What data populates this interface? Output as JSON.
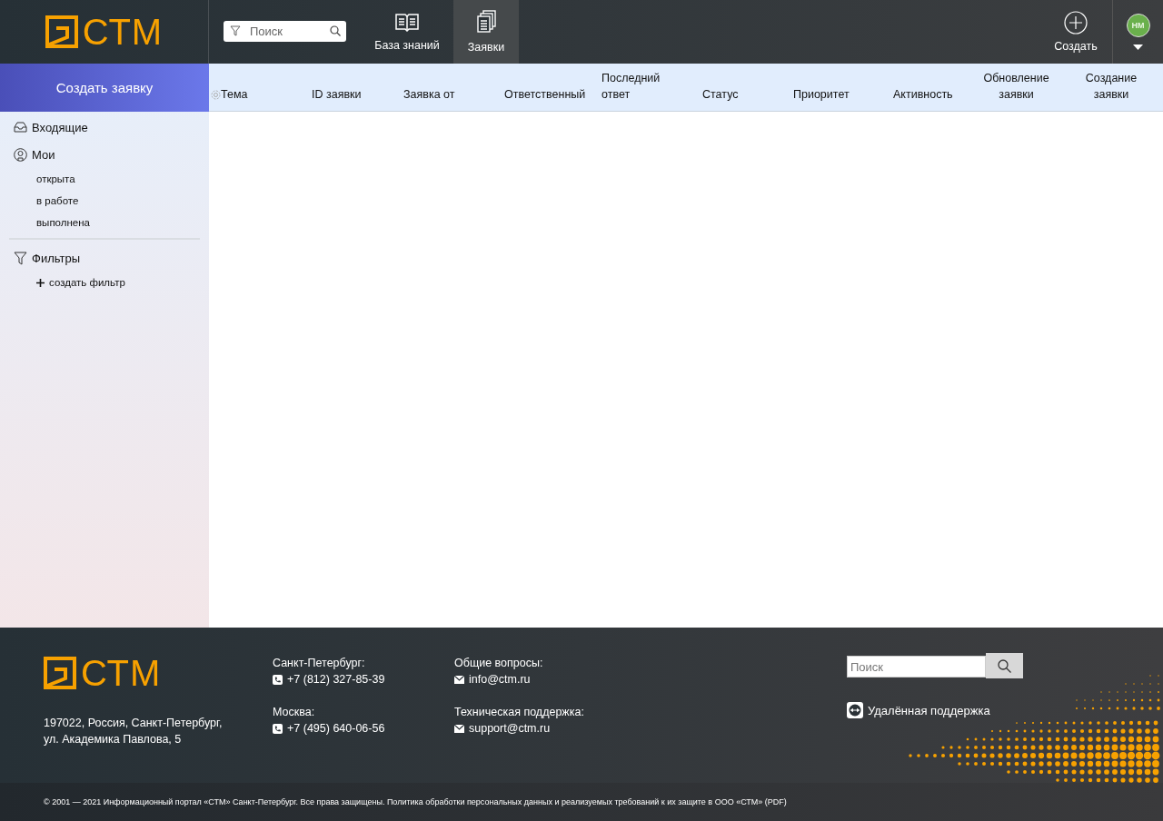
{
  "header": {
    "logo": "СТМ",
    "search": {
      "placeholder": "Поиск"
    },
    "nav": [
      {
        "label": "База знаний",
        "selected": false
      },
      {
        "label": "Заявки",
        "selected": true
      }
    ],
    "create": "Создать",
    "user": {
      "initials": "НМ"
    }
  },
  "sidebar": {
    "create_button": "Создать заявку",
    "items": [
      {
        "label": "Входящие"
      },
      {
        "label": "Мои",
        "children": [
          {
            "label": "открыта"
          },
          {
            "label": "в работе"
          },
          {
            "label": "выполнена"
          }
        ]
      }
    ],
    "filters": {
      "label": "Фильтры",
      "create": "создать фильтр"
    }
  },
  "table": {
    "columns": [
      "Тема",
      "ID заявки",
      "Заявка от",
      "Ответственный",
      "Последний ответ",
      "Статус",
      "Приоритет",
      "Активность",
      "Обновление заявки",
      "Создание заявки"
    ]
  },
  "footer": {
    "logo": "СТМ",
    "address": [
      "197022, Россия, Санкт-Петербург,",
      "ул. Академика Павлова, 5"
    ],
    "contacts": [
      {
        "title": "Санкт-Петербург:",
        "value": "+7 (812) 327-85-39",
        "kind": "phone"
      },
      {
        "title": "Москва:",
        "value": "+7 (495) 640-06-56",
        "kind": "phone"
      },
      {
        "title": "Общие вопросы:",
        "value": "info@ctm.ru",
        "kind": "mail"
      },
      {
        "title": "Техническая поддержка:",
        "value": "support@ctm.ru",
        "kind": "mail"
      }
    ],
    "search": {
      "placeholder": "Поиск"
    },
    "remote": "Удалённая поддержка",
    "copyright": "© 2001 — 2021 Информационный портал «СТМ» Санкт-Петербург. Все права защищены. Политика обработки персональных данных и реализуемых требований к их защите в ООО «СТМ» (PDF)"
  }
}
